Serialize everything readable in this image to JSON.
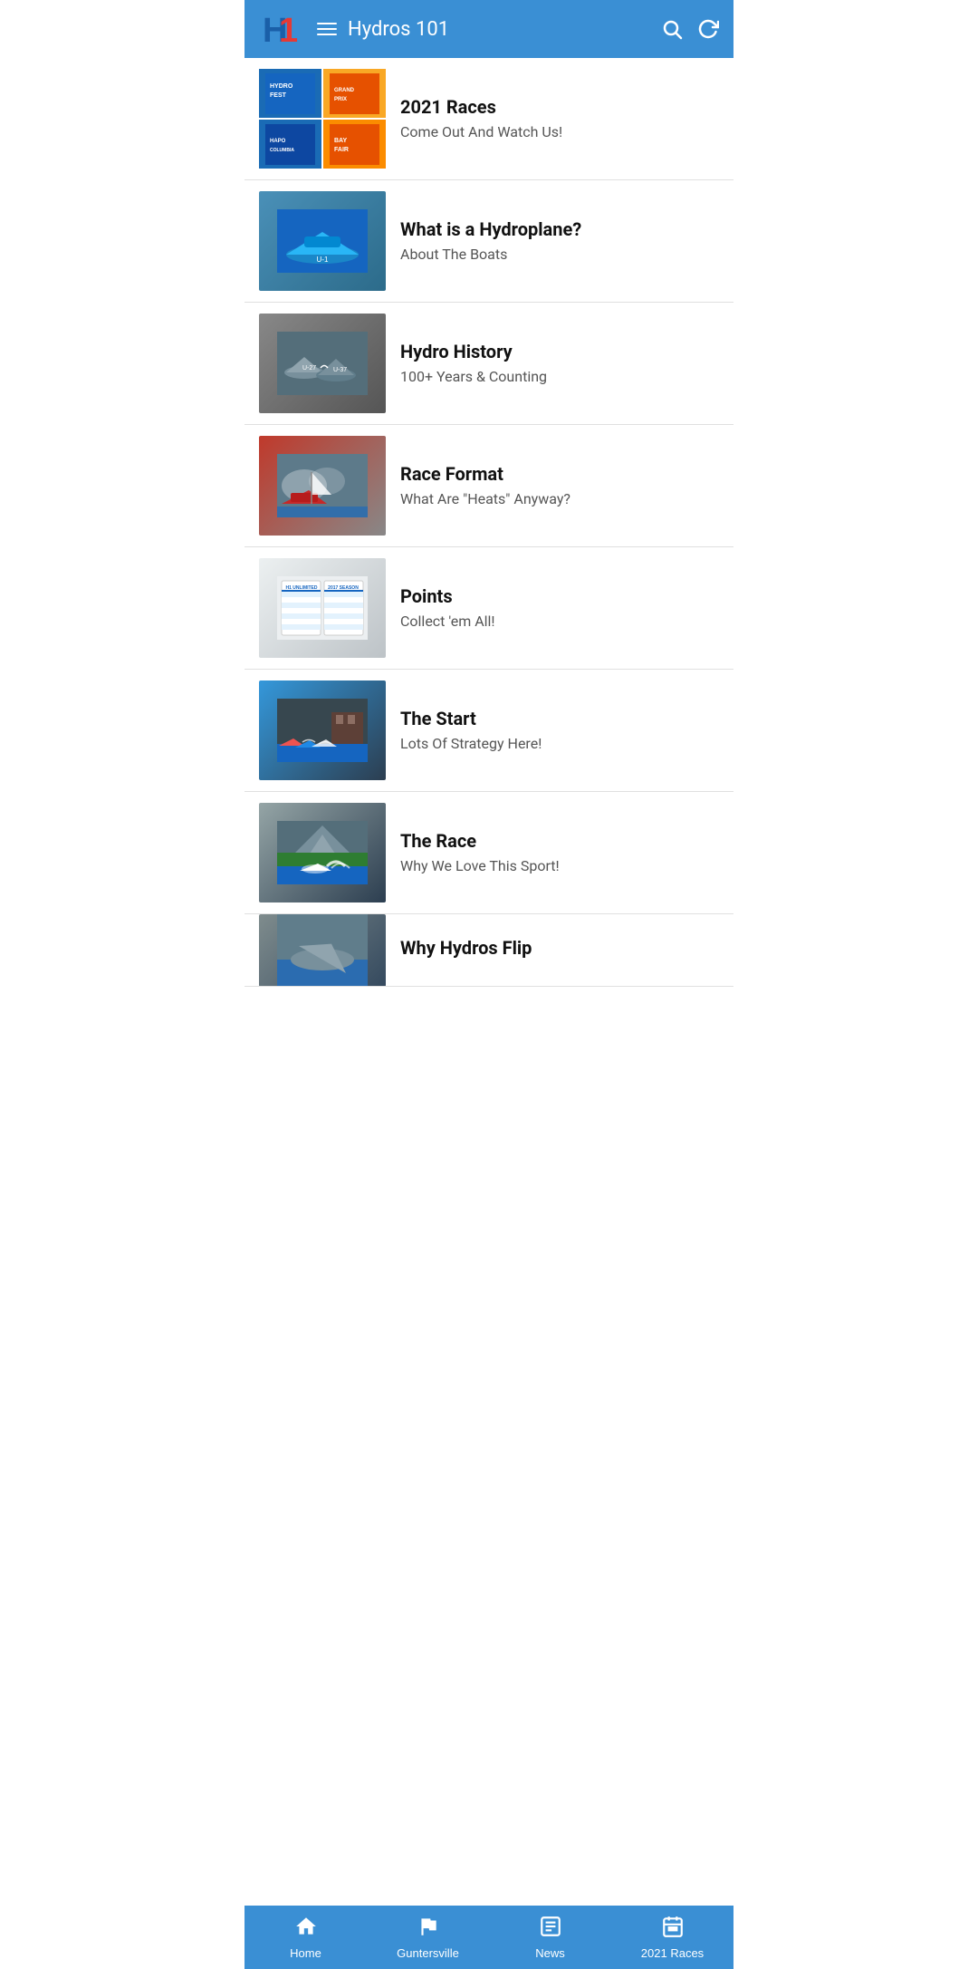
{
  "header": {
    "title": "Hydros 101",
    "search_label": "Search",
    "refresh_label": "Refresh"
  },
  "list_items": [
    {
      "id": "races-2021",
      "title": "2021 Races",
      "subtitle": "Come Out And Watch Us!",
      "image_type": "multi"
    },
    {
      "id": "what-is-hydroplane",
      "title": "What is a Hydroplane?",
      "subtitle": "About The Boats",
      "image_type": "single",
      "image_class": "img-hydro"
    },
    {
      "id": "hydro-history",
      "title": "Hydro History",
      "subtitle": "100+ Years & Counting",
      "image_type": "single",
      "image_class": "img-history"
    },
    {
      "id": "race-format",
      "title": "Race Format",
      "subtitle": "What Are \"Heats\" Anyway?",
      "image_type": "single",
      "image_class": "img-format"
    },
    {
      "id": "points",
      "title": "Points",
      "subtitle": "Collect 'em All!",
      "image_type": "single",
      "image_class": "img-points"
    },
    {
      "id": "the-start",
      "title": "The Start",
      "subtitle": "Lots Of Strategy Here!",
      "image_type": "single",
      "image_class": "img-start"
    },
    {
      "id": "the-race",
      "title": "The Race",
      "subtitle": "Why We Love This Sport!",
      "image_type": "single",
      "image_class": "img-race"
    },
    {
      "id": "why-hydros-flip",
      "title": "Why Hydros Flip",
      "subtitle": "",
      "image_type": "single",
      "image_class": "img-flip",
      "partial": true
    }
  ],
  "bottom_nav": [
    {
      "id": "home",
      "label": "Home",
      "icon": "home"
    },
    {
      "id": "guntersville",
      "label": "Guntersville",
      "icon": "flag"
    },
    {
      "id": "news",
      "label": "News",
      "icon": "news"
    },
    {
      "id": "races-2021-nav",
      "label": "2021 Races",
      "icon": "calendar"
    }
  ]
}
